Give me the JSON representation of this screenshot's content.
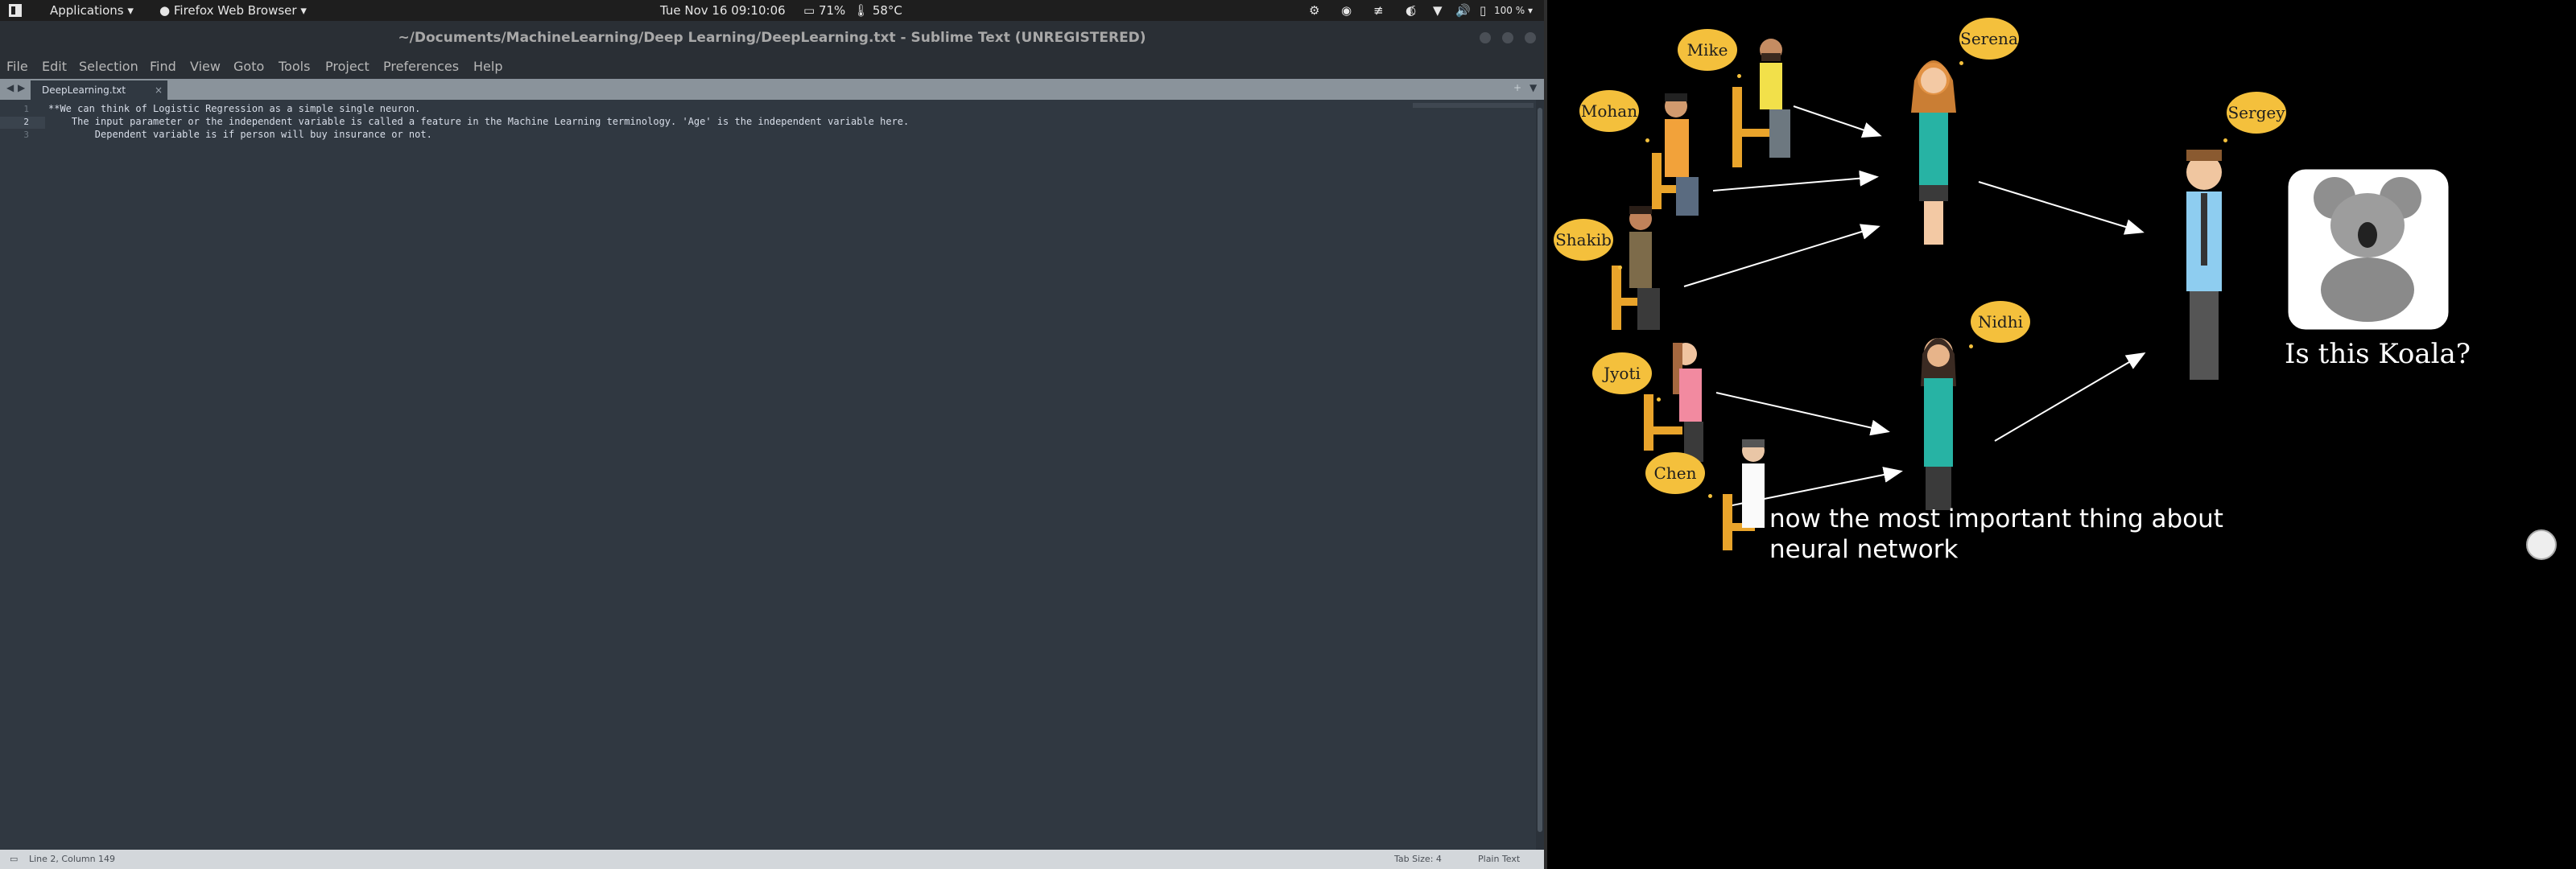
{
  "topbar": {
    "applications_label": "Applications",
    "browser_label": "Firefox Web Browser",
    "datetime": "Tue Nov 16  09:10:06",
    "battery": "71%",
    "temperature": "58°C",
    "zoom": "100 %"
  },
  "window": {
    "title": "~/Documents/MachineLearning/Deep Learning/DeepLearning.txt - Sublime Text (UNREGISTERED)"
  },
  "menu": [
    "File",
    "Edit",
    "Selection",
    "Find",
    "View",
    "Goto",
    "Tools",
    "Project",
    "Preferences",
    "Help"
  ],
  "tab": {
    "label": "DeepLearning.txt",
    "close": "×"
  },
  "editor": {
    "line_numbers": [
      "1",
      "2",
      "3"
    ],
    "lines": [
      "**We can think of Logistic Regression as a simple single neuron.",
      "    The input parameter or the independent variable is called a feature in the Machine Learning terminology. 'Age' is the independent variable here.",
      "        Dependent variable is if person will buy insurance or not."
    ]
  },
  "statusbar": {
    "position": "Line 2, Column 149",
    "tab_size": "Tab Size: 4",
    "syntax": "Plain Text"
  },
  "video": {
    "names": {
      "mike": "Mike",
      "serena": "Serena",
      "mohan": "Mohan",
      "sergey": "Sergey",
      "shakib": "Shakib",
      "nidhi": "Nidhi",
      "jyoti": "Jyoti",
      "chen": "Chen"
    },
    "subtitle_line1": "now the most important thing about",
    "subtitle_line2": "neural network",
    "koala_caption": "Is this Koala?"
  },
  "colors": {
    "editor_bg": "#303841",
    "bubble": "#f4c03c",
    "video_bg": "#000000"
  }
}
